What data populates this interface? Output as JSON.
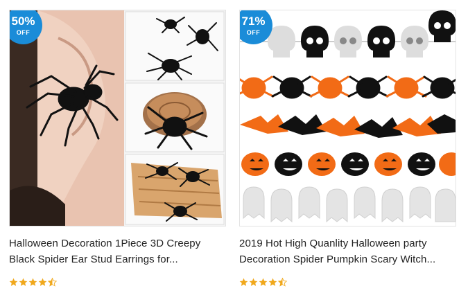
{
  "products": [
    {
      "discount": "50%",
      "discount_suffix": "OFF",
      "title_line1": "Halloween Decoration 1Piece 3D Creepy",
      "title_line2": "Black Spider Ear Stud Earrings for...",
      "rating": 4.5,
      "image_icon": "spider-earring-photo"
    },
    {
      "discount": "71%",
      "discount_suffix": "OFF",
      "title_line1": "2019 Hot High Quanlity Halloween party",
      "title_line2": "Decoration Spider Pumpkin Scary Witch...",
      "rating": 4.5,
      "image_icon": "halloween-garland-photo"
    }
  ],
  "colors": {
    "badge": "#1a8cd8",
    "star": "#f0a81c",
    "orange": "#f26b16",
    "black": "#111111"
  }
}
